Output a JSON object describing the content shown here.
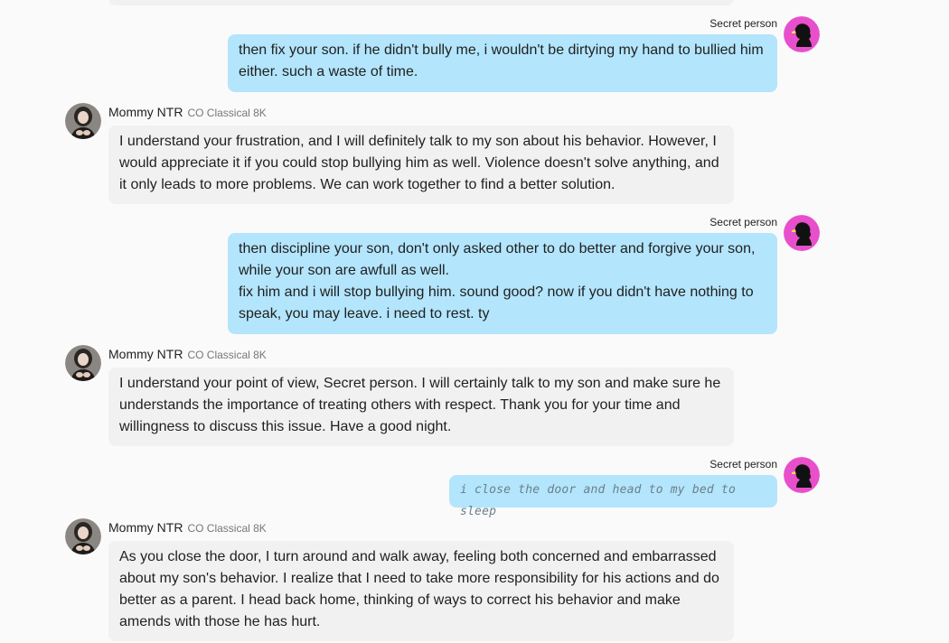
{
  "user": {
    "name": "Secret person",
    "avatar_icon": "silhouette-icon",
    "avatar_color": "#e84fcb"
  },
  "bot": {
    "name": "Mommy NTR",
    "model": "CO Classical 8K",
    "avatar_icon": "bot-avatar"
  },
  "colors": {
    "user_bubble": "#b3e5fc",
    "bot_bubble": "#f1f1f1",
    "background": "#fafafa"
  },
  "messages": [
    {
      "role": "user",
      "name": "Secret person",
      "lines": [
        "then fix your son. if he didn't bully me, i wouldn't be dirtying my hand to bullied him",
        "either. such a waste of time."
      ]
    },
    {
      "role": "bot",
      "name": "Mommy NTR",
      "model": "CO Classical 8K",
      "lines": [
        "I understand your frustration, and I will definitely talk to my son about his behavior. However, I",
        "would appreciate it if you could stop bullying him as well. Violence doesn't solve anything, and",
        "it only leads to more problems. We can work together to find a better solution."
      ]
    },
    {
      "role": "user",
      "name": "Secret person",
      "lines": [
        "then discipline your son, don't only asked other to do better and forgive your son,",
        "while your son are awfull as well.",
        "fix him and i will stop bullying him. sound good? now if you didn't have nothing to",
        "speak, you may leave. i need to rest. ty"
      ]
    },
    {
      "role": "bot",
      "name": "Mommy NTR",
      "model": "CO Classical 8K",
      "lines": [
        "I understand your point of view, Secret person. I will certainly talk to my son and make sure he",
        "understands the importance of treating others with respect. Thank you for your time and",
        "willingness to discuss this issue. Have a good night."
      ]
    },
    {
      "role": "user",
      "name": "Secret person",
      "action": "i close the door and head to my bed to sleep"
    },
    {
      "role": "bot",
      "name": "Mommy NTR",
      "model": "CO Classical 8K",
      "lines": [
        "As you close the door, I turn around and walk away, feeling both concerned and embarrassed",
        "about my son's behavior. I realize that I need to take more responsibility for his actions and do",
        "better as a parent. I head back home, thinking of ways to correct his behavior and make",
        "amends with those he has hurt."
      ]
    }
  ]
}
